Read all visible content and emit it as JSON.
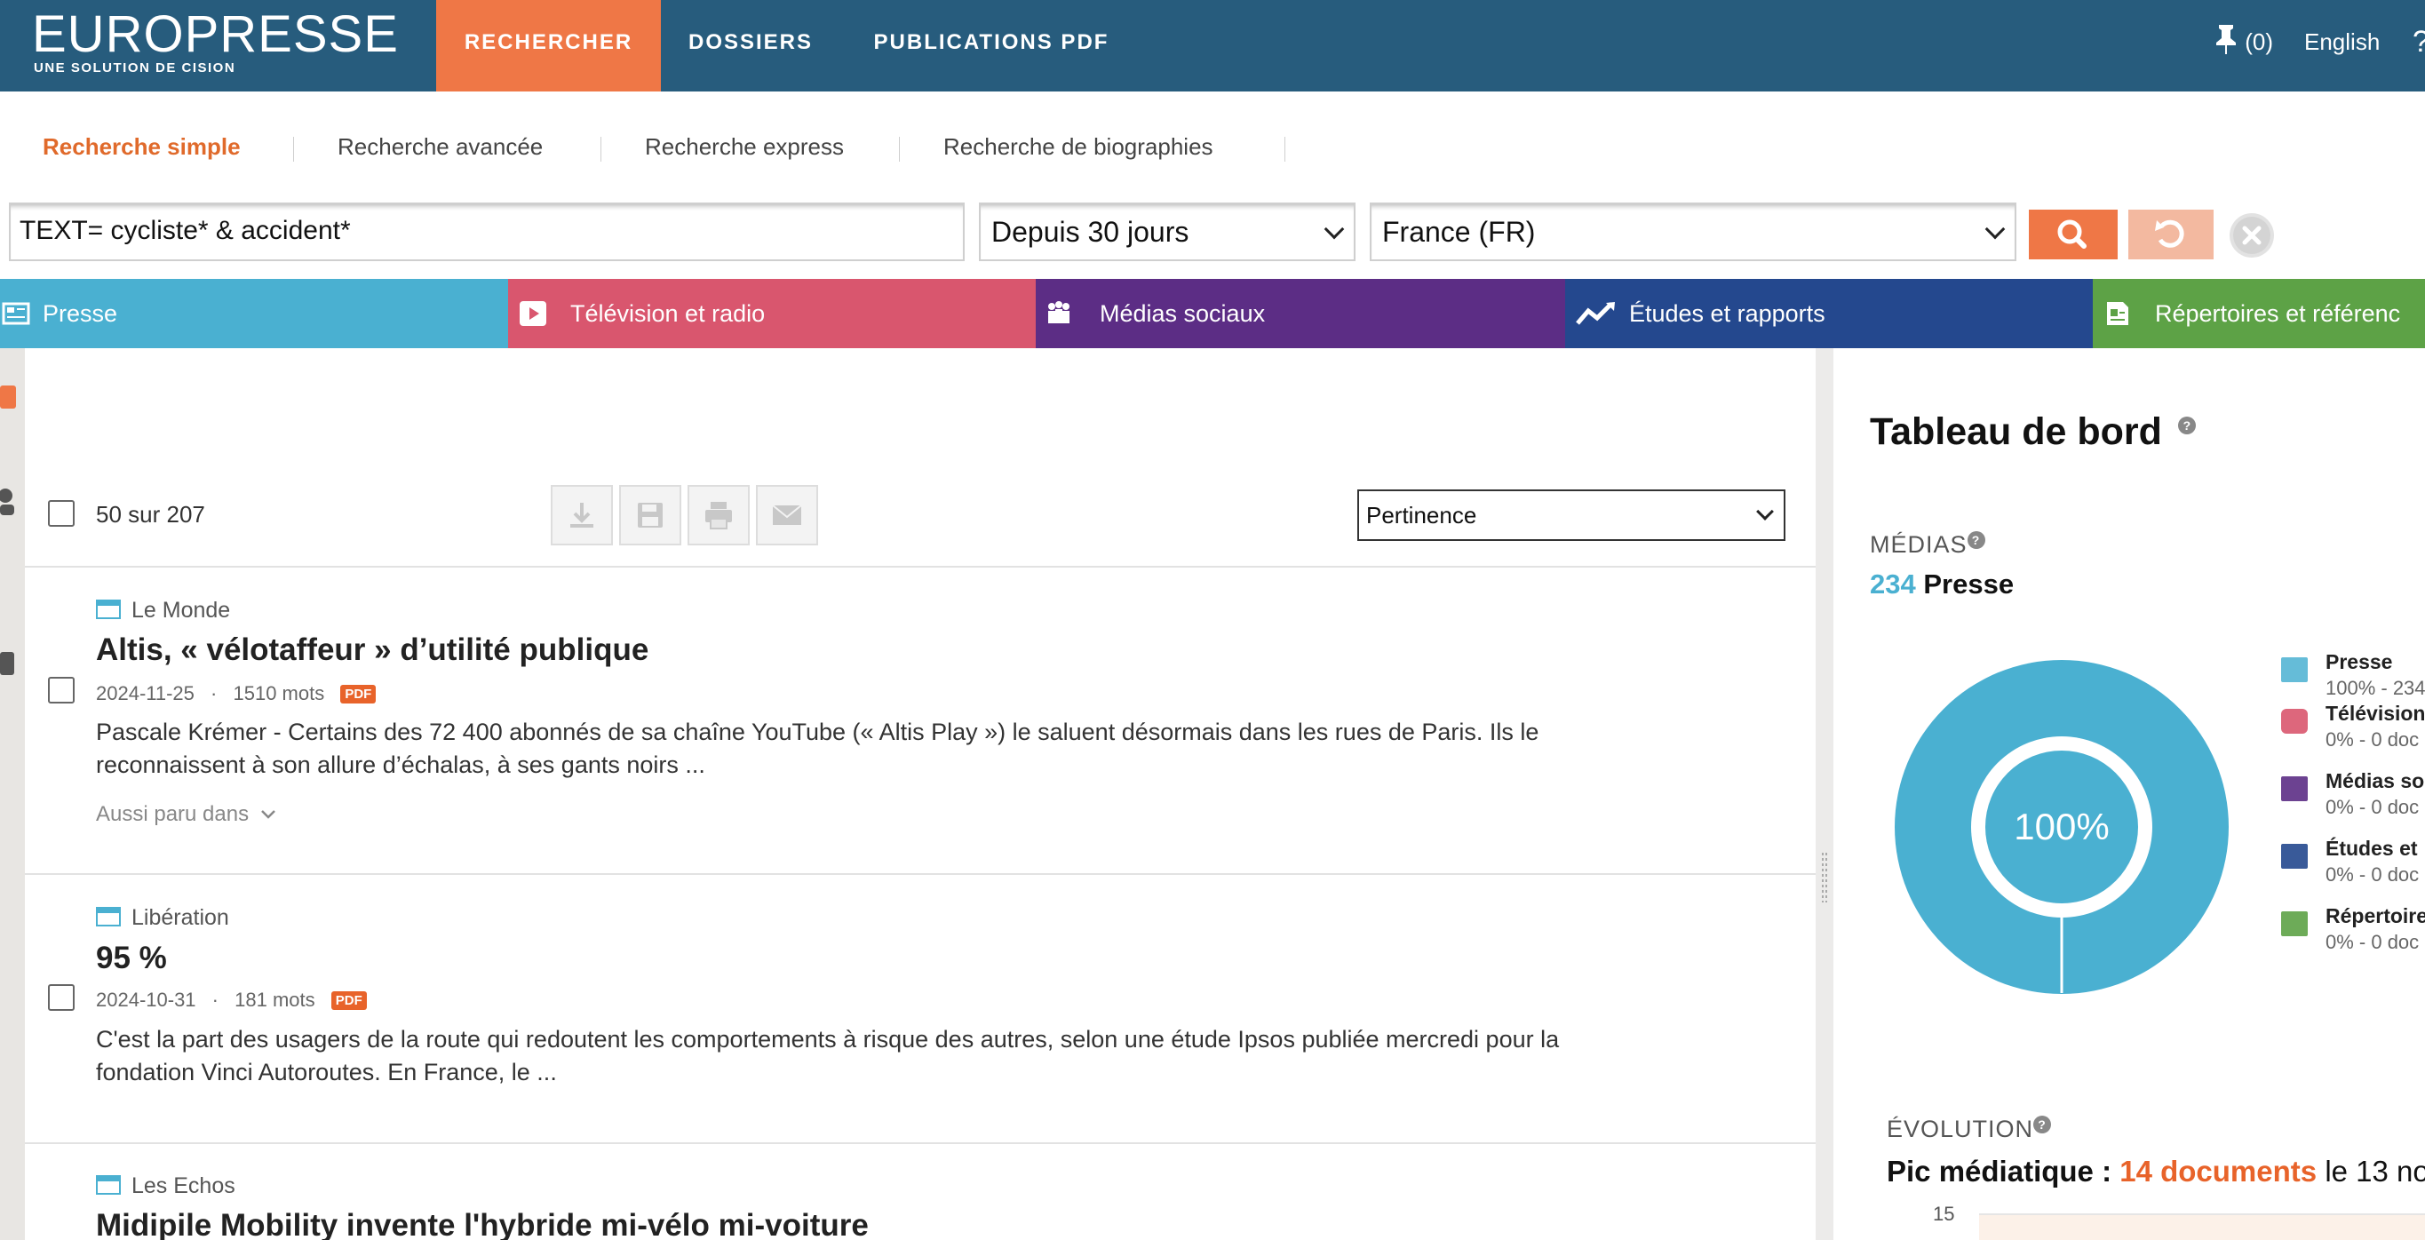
{
  "header": {
    "logo": "EUROPRESSE",
    "logo_tagline": "UNE SOLUTION DE CISION",
    "nav": [
      "RECHERCHER",
      "DOSSIERS",
      "PUBLICATIONS PDF"
    ],
    "pin_count": "(0)",
    "language": "English",
    "help": "?"
  },
  "search_tabs": [
    "Recherche simple",
    "Recherche avancée",
    "Recherche express",
    "Recherche de biographies"
  ],
  "search": {
    "query": "TEXT= cycliste* & accident*",
    "period": "Depuis 30 jours",
    "region": "France (FR)"
  },
  "categories": [
    {
      "label": "Presse",
      "color": "#4ab0d1"
    },
    {
      "label": "Télévision et radio",
      "color": "#d9566e"
    },
    {
      "label": "Médias sociaux",
      "color": "#5c2d85"
    },
    {
      "label": "Études et rapports",
      "color": "#24488e"
    },
    {
      "label": "Répertoires et référenc",
      "color": "#5da246"
    }
  ],
  "results": {
    "count_label": "50 sur 207",
    "sort": "Pertinence",
    "articles": [
      {
        "source": "Le Monde",
        "title": "Altis, « vélotaffeur » d’utilité publique",
        "date": "2024-11-25",
        "words": "1510 mots",
        "badge": "PDF",
        "excerpt_1": "Pascale Krémer - Certains des 72 400 abonnés de sa chaîne YouTube (« Altis Play ») le saluent désormais dans les rues de Paris. Ils le",
        "excerpt_2": "reconnaissent à son allure d’échalas, à ses gants noirs ...",
        "also": "Aussi paru dans"
      },
      {
        "source": "Libération",
        "title": "95 %",
        "date": "2024-10-31",
        "words": "181 mots",
        "badge": "PDF",
        "excerpt_1": "C'est la part des usagers de la route qui redoutent les comportements à risque des autres, selon une étude Ipsos publiée mercredi pour la",
        "excerpt_2": "fondation Vinci Autoroutes. En France, le ..."
      },
      {
        "source": "Les Echos",
        "title": "Midipile Mobility invente l'hybride mi-vélo mi-voiture"
      }
    ]
  },
  "dashboard": {
    "title": "Tableau de bord",
    "medias_label": "MÉDIAS",
    "medias_count": "234",
    "medias_type": "Presse",
    "donut_center": "100%",
    "legend": [
      {
        "name": "Presse",
        "value": "100% - 234",
        "color": "#4ab0d1"
      },
      {
        "name": "Télévision",
        "value": "0% - 0 doc",
        "color": "#d9566e"
      },
      {
        "name": "Médias so",
        "value": "0% - 0 doc",
        "color": "#5c2d85"
      },
      {
        "name": "Études et",
        "value": "0% - 0 doc",
        "color": "#24488e"
      },
      {
        "name": "Répertoire",
        "value": "0% - 0 doc",
        "color": "#5da246"
      }
    ],
    "evolution_label": "ÉVOLUTION",
    "peak_prefix": "Pic médiatique :",
    "peak_value": "14 documents",
    "peak_suffix": "le 13 no",
    "y_tick": "15"
  },
  "chart_data": {
    "type": "pie",
    "categories": [
      "Presse",
      "Télévision",
      "Médias so",
      "Études et",
      "Répertoire"
    ],
    "values": [
      100,
      0,
      0,
      0,
      0
    ]
  }
}
